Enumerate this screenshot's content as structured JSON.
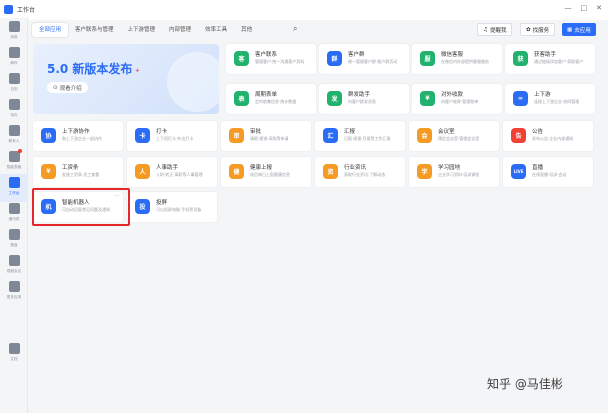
{
  "window": {
    "title": "工作台",
    "controls": [
      "—",
      "□",
      "✕"
    ]
  },
  "sidebar": {
    "items": [
      {
        "label": "消息",
        "icon": "chat-icon",
        "badge": false
      },
      {
        "label": "邮件",
        "icon": "mail-icon",
        "badge": false
      },
      {
        "label": "日历",
        "icon": "calendar-icon",
        "badge": false
      },
      {
        "label": "待办",
        "icon": "todo-icon",
        "badge": false
      },
      {
        "label": "联系人",
        "icon": "contacts-icon",
        "badge": false
      },
      {
        "label": "智能表格",
        "icon": "sheet-icon",
        "badge": true
      },
      {
        "label": "工作台",
        "icon": "grid-icon",
        "badge": false,
        "active": true
      },
      {
        "label": "通讯录",
        "icon": "people-icon",
        "badge": false
      },
      {
        "label": "微盘",
        "icon": "drive-icon",
        "badge": false
      },
      {
        "label": "视频会议",
        "icon": "video-icon",
        "badge": false
      },
      {
        "label": "更多应用",
        "icon": "apps-icon",
        "badge": false
      },
      {
        "label": "文档",
        "icon": "doc-icon",
        "badge": false
      }
    ]
  },
  "tabs": [
    "全部应用",
    "客户联系与管理",
    "上下游管理",
    "内部管理",
    "效率工具",
    "其他"
  ],
  "toolbar": {
    "helper": "提醒我",
    "service": "找服务",
    "use": "去应用"
  },
  "banner": {
    "title": "5.0 新版本发布",
    "watch": "观看介绍"
  },
  "apps": [
    {
      "name": "客户联系",
      "desc": "管理客户·统一沟通客户资料",
      "color": "#23b26d",
      "glyph": "客"
    },
    {
      "name": "客户群",
      "desc": "统一管理客户群·客户群活动",
      "color": "#2a6cf6",
      "glyph": "群"
    },
    {
      "name": "微信客服",
      "desc": "在微信内外部提供客服服务",
      "color": "#23b26d",
      "glyph": "服"
    },
    {
      "name": "获客助手",
      "desc": "通过链接添加客户·获取客户",
      "color": "#23b26d",
      "glyph": "获"
    },
    {
      "name": "周期表单",
      "desc": "定时收集信息·统计数据",
      "color": "#23b26d",
      "glyph": "表"
    },
    {
      "name": "群发助手",
      "desc": "向客户群发消息",
      "color": "#23b26d",
      "glyph": "发"
    },
    {
      "name": "对外收款",
      "desc": "向客户收款·管理账单",
      "color": "#23b26d",
      "glyph": "¥"
    },
    {
      "name": "上下游",
      "desc": "连接上下游企业·协同管理",
      "color": "#2a6cf6",
      "glyph": "∞"
    },
    {
      "name": "上下游协作",
      "desc": "和上下游企业一起协作",
      "color": "#2a6cf6",
      "glyph": "协"
    },
    {
      "name": "打卡",
      "desc": "上下班打卡·外出打卡",
      "color": "#2a6cf6",
      "glyph": "卡"
    },
    {
      "name": "审批",
      "desc": "请假·报销·采购等申请",
      "color": "#f59a23",
      "glyph": "审"
    },
    {
      "name": "汇报",
      "desc": "日报·周报·月报等工作汇报",
      "color": "#2a6cf6",
      "glyph": "汇"
    },
    {
      "name": "会议室",
      "desc": "预定会议室·管理会议室",
      "color": "#f59a23",
      "glyph": "会"
    },
    {
      "name": "公告",
      "desc": "发布公告·企业内部通知",
      "color": "#f04134",
      "glyph": "告"
    },
    {
      "name": "工资条",
      "desc": "发放工资条·员工查看",
      "color": "#f59a23",
      "glyph": "¥"
    },
    {
      "name": "人事助手",
      "desc": "入职·转正·离职等人事管理",
      "color": "#f59a23",
      "glyph": "人"
    },
    {
      "name": "健康上报",
      "desc": "成员每日上报健康信息",
      "color": "#f59a23",
      "glyph": "健"
    },
    {
      "name": "行业资讯",
      "desc": "获取行业资讯·了解动态",
      "color": "#f59a23",
      "glyph": "资"
    },
    {
      "name": "学习园地",
      "desc": "企业学习资料·培训课程",
      "color": "#f59a23",
      "glyph": "学"
    },
    {
      "name": "直播",
      "desc": "在线直播·培训·会议",
      "color": "#2a6cf6",
      "glyph": "LIVE"
    },
    {
      "name": "智能机器人",
      "desc": "可自动回复常见问题及通知",
      "color": "#2a6cf6",
      "glyph": "机"
    },
    {
      "name": "投屏",
      "desc": "可以投屏电脑·手机等设备",
      "color": "#2a6cf6",
      "glyph": "投"
    }
  ],
  "watermark": "知乎 @马佳彬",
  "colors": {
    "accent": "#2a6cf6",
    "highlight": "#e5262a"
  }
}
